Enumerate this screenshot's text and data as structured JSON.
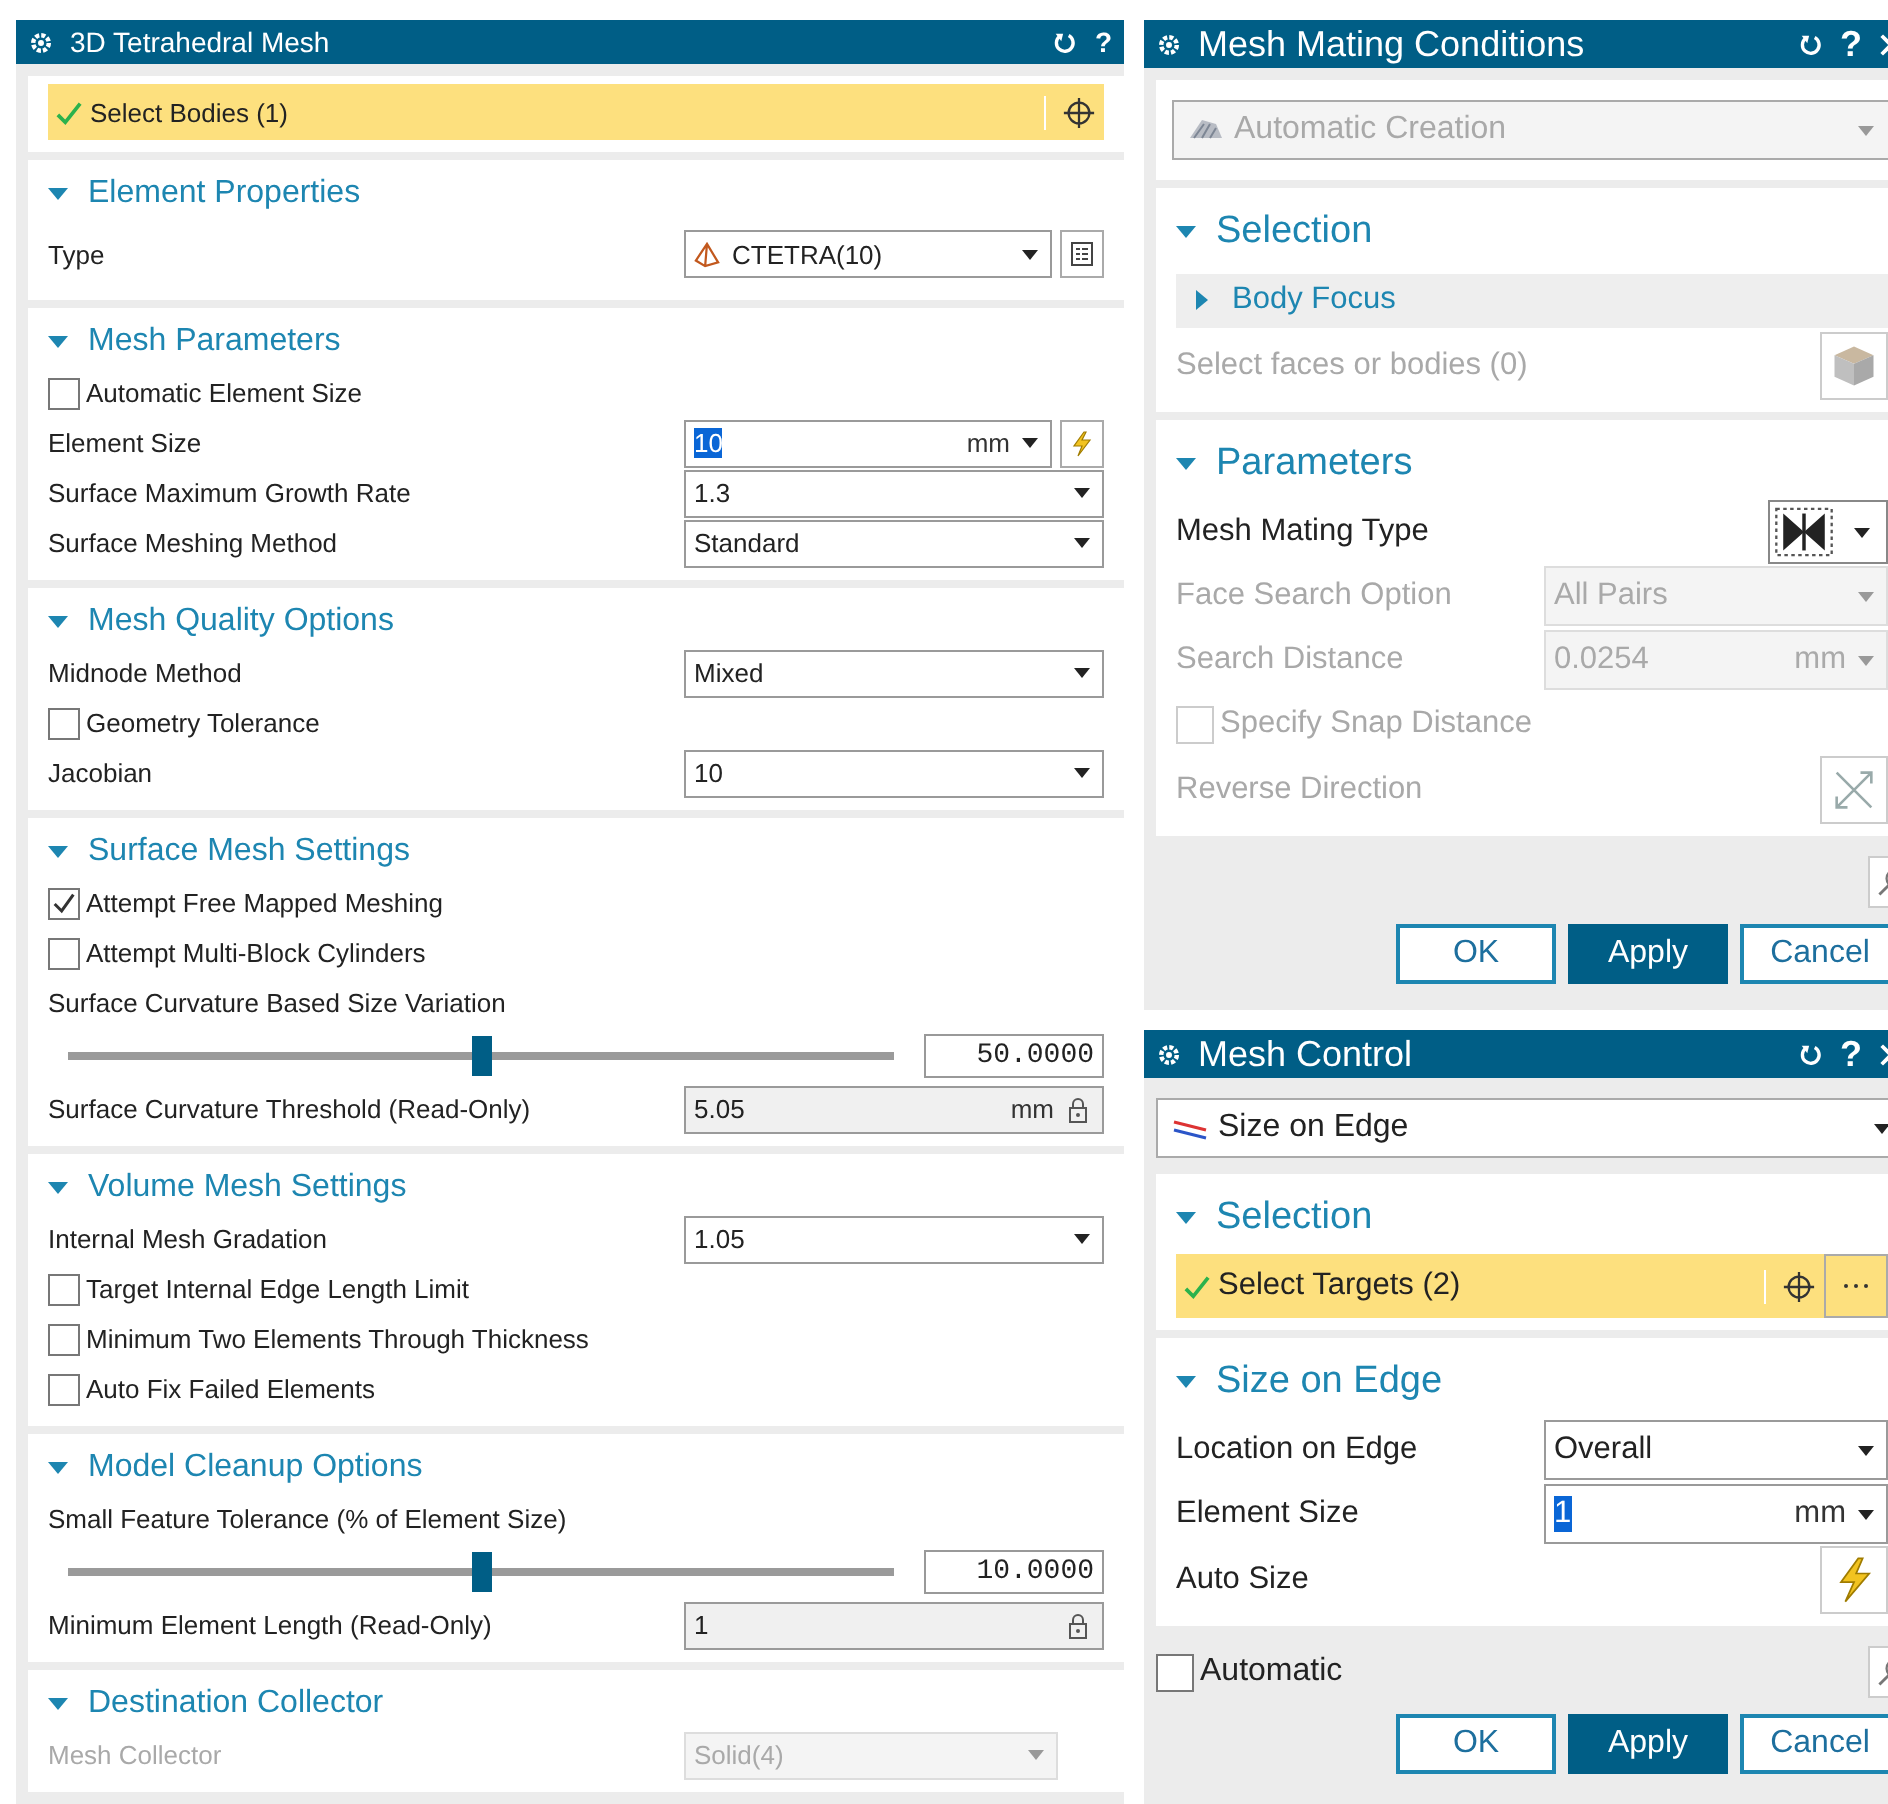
{
  "panels": [
    {
      "title": "3D Tetrahedral Mesh",
      "help": "?",
      "blocks": [
        {
          "kind": "select-bar",
          "label": "Select Bodies (1)",
          "checked": true
        },
        {
          "kind": "section",
          "title": "Element Properties",
          "expanded": true,
          "rows": [
            {
              "kind": "type-select",
              "label": "Type",
              "value": "CTETRA(10)",
              "disabled": false
            }
          ]
        },
        {
          "kind": "section",
          "title": "Mesh Parameters",
          "expanded": true,
          "rows": [
            {
              "kind": "check",
              "label": "Automatic Element Size",
              "checked": false,
              "disabled": false
            },
            {
              "kind": "size-input",
              "label": "Element Size",
              "value": "10",
              "unit": "mm",
              "selected": true,
              "disabled": false
            },
            {
              "kind": "select",
              "label": "Surface Maximum Growth Rate",
              "value": "1.3",
              "disabled": false
            },
            {
              "kind": "select",
              "label": "Surface Meshing Method",
              "value": "Standard",
              "disabled": false
            }
          ]
        },
        {
          "kind": "section",
          "title": "Mesh Quality Options",
          "expanded": true,
          "rows": [
            {
              "kind": "select",
              "label": "Midnode Method",
              "value": "Mixed",
              "disabled": false
            },
            {
              "kind": "check",
              "label": "Geometry Tolerance",
              "checked": false,
              "disabled": false
            },
            {
              "kind": "select",
              "label": "Jacobian",
              "value": "10",
              "disabled": false
            }
          ]
        },
        {
          "kind": "section",
          "title": "Surface Mesh Settings",
          "expanded": true,
          "rows": [
            {
              "kind": "check",
              "label": "Attempt Free Mapped Meshing",
              "checked": true,
              "disabled": false
            },
            {
              "kind": "check",
              "label": "Attempt Multi-Block Cylinders",
              "checked": false,
              "disabled": false
            },
            {
              "kind": "caption",
              "label": "Surface Curvature Based Size Variation"
            },
            {
              "kind": "slider",
              "level": 0.5,
              "value": "50.0000"
            },
            {
              "kind": "readonly",
              "label": "Surface Curvature Threshold (Read-Only)",
              "value": "5.05",
              "unit": "mm"
            }
          ]
        },
        {
          "kind": "section",
          "title": "Volume Mesh Settings",
          "expanded": true,
          "rows": [
            {
              "kind": "select",
              "label": "Internal Mesh Gradation",
              "value": "1.05",
              "disabled": false
            },
            {
              "kind": "check",
              "label": "Target Internal Edge Length Limit",
              "checked": false,
              "disabled": false
            },
            {
              "kind": "check",
              "label": "Minimum Two Elements Through Thickness",
              "checked": false,
              "disabled": false
            },
            {
              "kind": "check",
              "label": "Auto Fix Failed Elements",
              "checked": false,
              "disabled": false
            }
          ]
        },
        {
          "kind": "section",
          "title": "Model Cleanup Options",
          "expanded": true,
          "rows": [
            {
              "kind": "caption",
              "label": "Small Feature Tolerance (% of Element Size)"
            },
            {
              "kind": "slider",
              "level": 0.5,
              "value": "10.0000"
            },
            {
              "kind": "readonly",
              "label": "Minimum Element Length (Read-Only)",
              "value": "1"
            }
          ]
        },
        {
          "kind": "section",
          "title": "Destination Collector",
          "expanded": true,
          "rows": [
            {
              "kind": "select",
              "label": "Mesh Collector",
              "value": "Solid(4)",
              "disabled": true
            }
          ]
        }
      ]
    },
    {
      "title": "Mesh Mating Conditions",
      "help": "?",
      "blocks": [
        {
          "kind": "auto-mode-select",
          "value": "Automatic Creation",
          "disabled": true
        },
        {
          "kind": "section",
          "title": "Selection",
          "expanded": true,
          "rows": [
            {
              "kind": "group",
              "label": "Body Focus",
              "expanded": false
            },
            {
              "kind": "face-pick",
              "label": "Select faces or bodies (0)",
              "disabled": true
            }
          ]
        },
        {
          "kind": "section",
          "title": "Parameters",
          "expanded": true,
          "rows": [
            {
              "kind": "mating-type",
              "label": "Mesh Mating Type"
            },
            {
              "kind": "select",
              "label": "Face Search Option",
              "value": "All Pairs",
              "disabled": true
            },
            {
              "kind": "unit-input",
              "label": "Search Distance",
              "value": "0.0254",
              "unit": "mm",
              "selected": false,
              "disabled": true
            },
            {
              "kind": "check",
              "label": "Specify Snap Distance",
              "checked": false,
              "disabled": true
            },
            {
              "kind": "reverse",
              "label": "Reverse Direction",
              "disabled": true
            }
          ]
        },
        {
          "kind": "footer",
          "buttons": [
            {
              "label": "OK",
              "primary": false
            },
            {
              "label": "Apply",
              "primary": true
            },
            {
              "label": "Cancel",
              "primary": false
            }
          ]
        }
      ]
    },
    {
      "title": "Mesh Control",
      "help": "?",
      "blocks": [
        {
          "kind": "edge-mode-select",
          "value": "Size on Edge",
          "disabled": false
        },
        {
          "kind": "section",
          "title": "Selection",
          "expanded": true,
          "rows": [
            {
              "kind": "target-bar",
              "label": "Select Targets (2)",
              "checked": true
            }
          ]
        },
        {
          "kind": "section",
          "title": "Size on Edge",
          "expanded": true,
          "rows": [
            {
              "kind": "select",
              "label": "Location on Edge",
              "value": "Overall",
              "disabled": false
            },
            {
              "kind": "unit-input",
              "label": "Element Size",
              "value": "1",
              "unit": "mm",
              "selected": true,
              "disabled": false
            },
            {
              "kind": "auto-size",
              "label": "Auto Size"
            }
          ]
        },
        {
          "kind": "footer",
          "checkbox": {
            "label": "Automatic",
            "checked": false
          },
          "buttons": [
            {
              "label": "OK",
              "primary": false
            },
            {
              "label": "Apply",
              "primary": true
            },
            {
              "label": "Cancel",
              "primary": false
            }
          ]
        }
      ]
    }
  ]
}
